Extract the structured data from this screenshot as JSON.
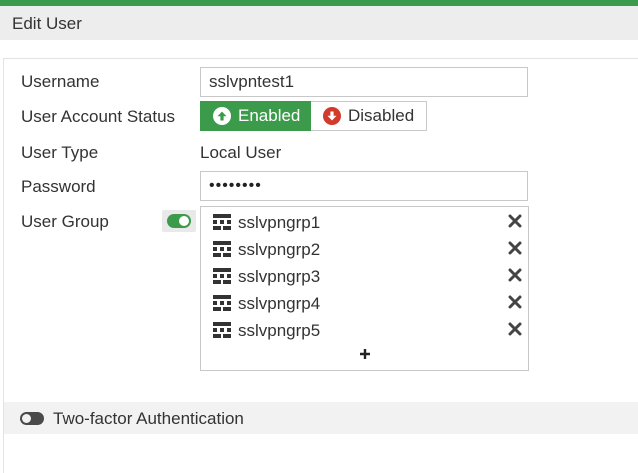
{
  "header": {
    "title": "Edit User"
  },
  "form": {
    "username": {
      "label": "Username",
      "value": "sslvpntest1"
    },
    "account_status": {
      "label": "User Account Status",
      "options": [
        "Enabled",
        "Disabled"
      ],
      "selected": "Enabled"
    },
    "user_type": {
      "label": "User Type",
      "value": "Local User"
    },
    "password": {
      "label": "Password",
      "masked_value": "••••••••"
    },
    "user_group": {
      "label": "User Group",
      "toggle_on": true,
      "groups": [
        {
          "name": "sslvpngrp1"
        },
        {
          "name": "sslvpngrp2"
        },
        {
          "name": "sslvpngrp3"
        },
        {
          "name": "sslvpngrp4"
        },
        {
          "name": "sslvpngrp5"
        }
      ]
    },
    "two_factor": {
      "label": "Two-factor Authentication",
      "toggle_on": false
    }
  },
  "colors": {
    "accent_green": "#3c9b4b",
    "disabled_red": "#d23b2b",
    "title_bar_bg": "#ededed"
  },
  "icons": {
    "enabled": "arrow-up-circle-icon",
    "disabled": "arrow-down-circle-icon",
    "group": "user-group-icon",
    "remove": "close-icon",
    "add": "plus-icon"
  }
}
